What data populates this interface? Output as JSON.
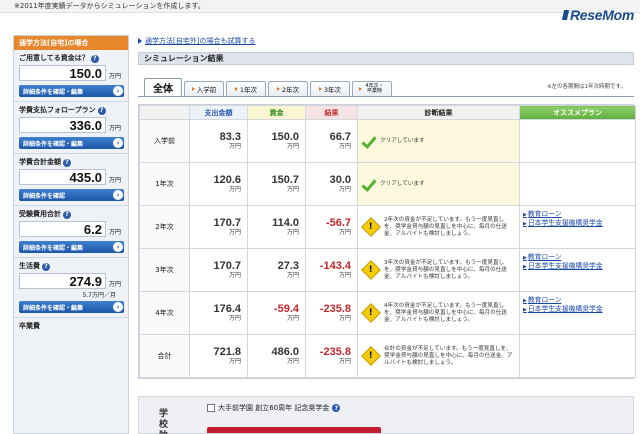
{
  "top_note": "※2011年度実績データからシミュレーションを作成します。",
  "logo": "ReseMom",
  "sidebar": {
    "header": "通学方法[自宅]の場合",
    "sections": [
      {
        "title": "ご用意してる資金は？",
        "value": "150.0",
        "unit": "万円",
        "button": "詳細条件を確認・編集"
      },
      {
        "title": "学費支払フォロープラン",
        "value": "336.0",
        "unit": "万円",
        "button": "詳細条件を確認・編集"
      },
      {
        "title": "学費合計金額",
        "value": "435.0",
        "unit": "万円",
        "button": "詳細条件を確認"
      },
      {
        "title": "受験費用合計",
        "value": "6.2",
        "unit": "万円",
        "button": "詳細条件を確認・編集"
      },
      {
        "title": "生活費",
        "value": "274.9",
        "unit": "万円",
        "sub": "5.7万円／月",
        "button": "詳細条件を確認・編集"
      },
      {
        "title": "卒業費",
        "value": "",
        "unit": "",
        "button": ""
      }
    ]
  },
  "main": {
    "top_link": "通学方法[自宅外]の場合も試算する",
    "sim_title": "シミュレーション結果",
    "tabs": [
      "全体",
      "入学前",
      "1年次",
      "2年次",
      "3年次",
      "4年次・卒業時"
    ],
    "note": "※左の各期間は1年次時期です。",
    "headers": {
      "amount": "支出金額",
      "fund": "資金",
      "result": "結果",
      "diagnosis": "診断結果",
      "recommend": "オススメプラン"
    },
    "rows": [
      {
        "label": "入学前",
        "amount": "83.3",
        "fund": "150.0",
        "result": "66.7",
        "negative": false,
        "status": "ok",
        "diagnosis": "クリアしています",
        "recs": []
      },
      {
        "label": "1年次",
        "amount": "120.6",
        "fund": "150.7",
        "result": "30.0",
        "negative": false,
        "status": "ok",
        "diagnosis": "クリアしています",
        "recs": []
      },
      {
        "label": "2年次",
        "amount": "170.7",
        "fund": "114.0",
        "result": "-56.7",
        "negative": true,
        "status": "warn",
        "diagnosis": "2年次の資金が不足しています。もう一度見直しを、奨学金貸与額の見直しを中心に、毎月の仕送金、アルバイトも検討しましょう。",
        "recs": [
          "教育ローン",
          "日本学生支援機構奨学金"
        ]
      },
      {
        "label": "3年次",
        "amount": "170.7",
        "fund": "27.3",
        "result": "-143.4",
        "negative": true,
        "status": "warn",
        "diagnosis": "3年次の資金が不足しています。もう一度見直しを、奨学金貸与額の見直しを中心に、毎月の仕送金、アルバイトも検討しましょう。",
        "recs": [
          "教育ローン",
          "日本学生支援機構奨学金"
        ]
      },
      {
        "label": "4年次",
        "amount": "176.4",
        "fund": "-59.4",
        "result": "-235.8",
        "negative": true,
        "fund_negative": true,
        "status": "warn",
        "diagnosis": "4年次の資金が不足しています。もう一度見直しを、奨学金貸与額の見直しを中心に、毎月の仕送金、アルバイトも検討しましょう。",
        "recs": [
          "教育ローン",
          "日本学生支援機構奨学金"
        ]
      },
      {
        "label": "合計",
        "amount": "721.8",
        "fund": "486.0",
        "result": "-235.8",
        "negative": true,
        "status": "warn",
        "diagnosis": "合計の資金が不足しています。もう一度見直しを、奨学金貸与額の見直しを中心に、毎月の仕送金、アルバイトも検討しましょう。",
        "recs": []
      }
    ],
    "unit": "万円"
  },
  "school": {
    "label": "学校独",
    "checkbox_label": "大手前学園 創立60周年 記念奨学金"
  }
}
